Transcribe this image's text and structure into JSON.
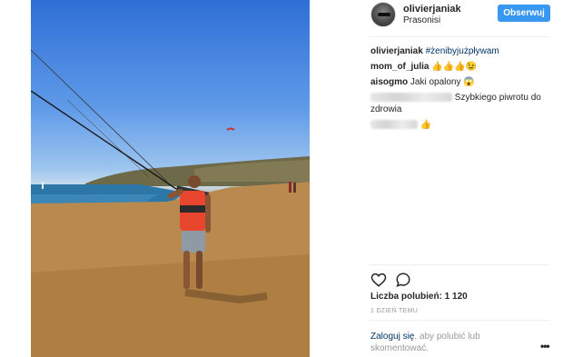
{
  "post": {
    "photo_icon": "kitesurf-beach-photo"
  },
  "header": {
    "username": "olivierjaniak",
    "location": "Prasonisi",
    "follow_label": "Obserwuj"
  },
  "caption": {
    "author": "olivierjaniak",
    "text": "#żenibyjużpływam"
  },
  "comments": [
    {
      "author": "mom_of_julia",
      "text": "👍👍👍😉"
    },
    {
      "author": "aisogmo",
      "text": "Jaki opalony 😱"
    },
    {
      "author": "",
      "text": "Szybkiego piwrotu do zdrowia"
    },
    {
      "author": "",
      "text": "👍"
    }
  ],
  "actions": {
    "like_icon": "heart-icon",
    "comment_icon": "comment-icon"
  },
  "likes": "Liczba polubień: 1 120",
  "timestamp": "1 DZIEŃ TEMU",
  "footer": {
    "login_link": "Zaloguj się",
    "login_rest": ", aby polubić lub skomentować.",
    "more_label": "•••"
  },
  "colors": {
    "accent": "#3897f0",
    "link": "#003569",
    "muted": "#999999"
  }
}
